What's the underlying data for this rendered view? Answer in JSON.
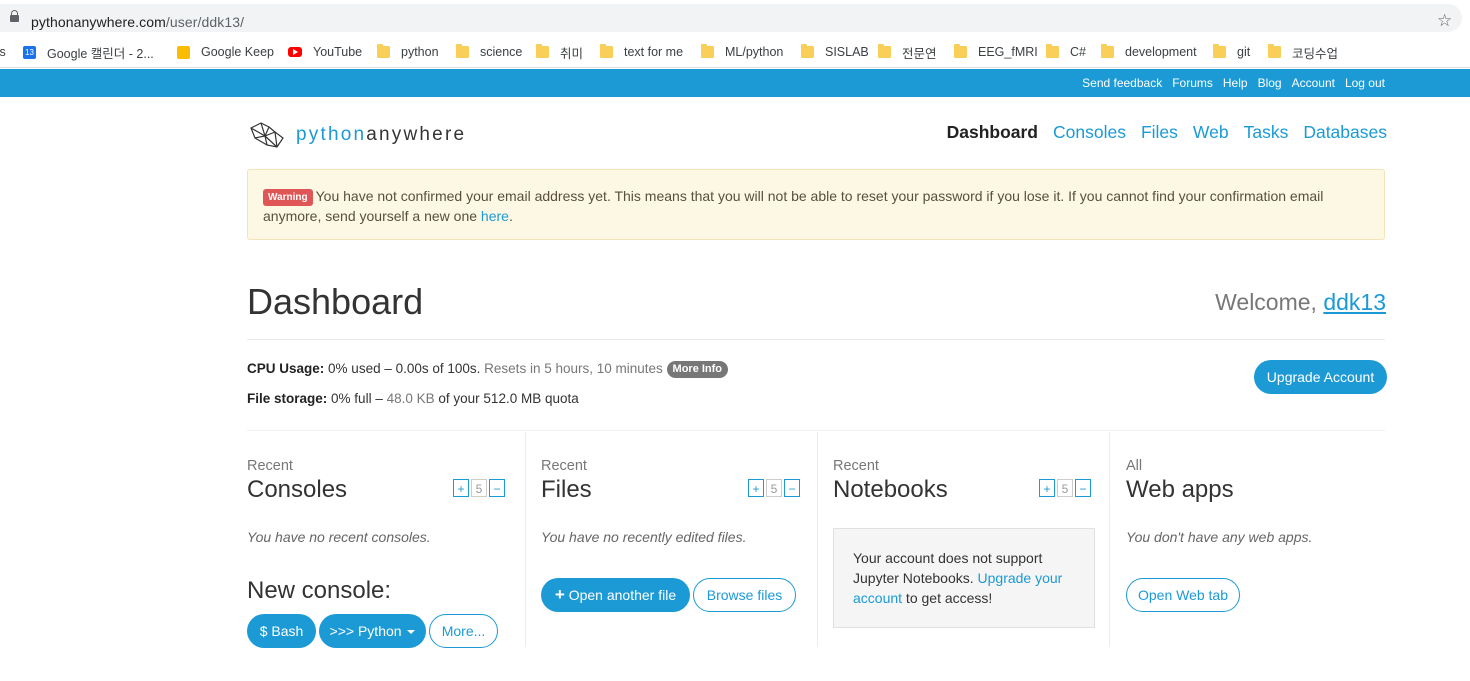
{
  "browser": {
    "url_host": "pythonanywhere.com",
    "url_path": "/user/ddk13/",
    "bookmarks": [
      {
        "label": "ts",
        "icon": "none"
      },
      {
        "label": "Google 캘린더 - 2...",
        "icon": "calendar-icon"
      },
      {
        "label": "Google Keep",
        "icon": "keep-icon"
      },
      {
        "label": "YouTube",
        "icon": "youtube-icon"
      },
      {
        "label": "python",
        "icon": "folder-icon"
      },
      {
        "label": "science",
        "icon": "folder-icon"
      },
      {
        "label": "취미",
        "icon": "folder-icon"
      },
      {
        "label": "text for me",
        "icon": "folder-icon"
      },
      {
        "label": "ML/python",
        "icon": "folder-icon"
      },
      {
        "label": "SISLAB",
        "icon": "folder-icon"
      },
      {
        "label": "전문연",
        "icon": "folder-icon"
      },
      {
        "label": "EEG_fMRI",
        "icon": "folder-icon"
      },
      {
        "label": "C#",
        "icon": "folder-icon"
      },
      {
        "label": "development",
        "icon": "folder-icon"
      },
      {
        "label": "git",
        "icon": "folder-icon"
      },
      {
        "label": "코딩수업",
        "icon": "folder-icon"
      }
    ],
    "calendar_badge": "13"
  },
  "topbar": {
    "links": [
      "Send feedback",
      "Forums",
      "Help",
      "Blog",
      "Account",
      "Log out"
    ],
    "color": "#1b9ad6"
  },
  "header": {
    "logo_part1": "python",
    "logo_part2": "anywhere",
    "nav": [
      "Dashboard",
      "Consoles",
      "Files",
      "Web",
      "Tasks",
      "Databases"
    ],
    "active_nav": "Dashboard"
  },
  "warning": {
    "badge": "Warning",
    "text": "You have not confirmed your email address yet. This means that you will not be able to reset your password if you lose it. If you cannot find your confirmation email anymore, send yourself a new one ",
    "link": "here",
    "end": "."
  },
  "dashboard": {
    "title": "Dashboard",
    "welcome_prefix": "Welcome, ",
    "username": "ddk13",
    "cpu_label": "CPU Usage:",
    "cpu_value": "0% used – 0.00s of 100s.",
    "cpu_reset": "Resets in 5 hours, 10 minutes",
    "more_info": "More Info",
    "storage_label": "File storage:",
    "storage_value_1": "0% full –",
    "storage_value_2": "48.0 KB",
    "storage_value_3": "of your 512.0 MB quota",
    "upgrade_button": "Upgrade Account"
  },
  "consoles": {
    "pre": "Recent",
    "title": "Consoles",
    "stepper": [
      "+",
      "5",
      "−"
    ],
    "empty": "You have no recent consoles.",
    "new_title": "New console:",
    "buttons": [
      "$ Bash",
      ">>> Python",
      "More..."
    ]
  },
  "files": {
    "pre": "Recent",
    "title": "Files",
    "stepper": [
      "+",
      "5",
      "−"
    ],
    "empty": "You have no recently edited files.",
    "open_button": "Open another file",
    "browse_button": "Browse files"
  },
  "notebooks": {
    "pre": "Recent",
    "title": "Notebooks",
    "stepper": [
      "+",
      "5",
      "−"
    ],
    "msg_1": "Your account does not support Jupyter Notebooks. ",
    "msg_link": "Upgrade your account",
    "msg_2": " to get access!"
  },
  "webapps": {
    "pre": "All",
    "title": "Web apps",
    "empty": "You don't have any web apps.",
    "button": "Open Web tab"
  }
}
